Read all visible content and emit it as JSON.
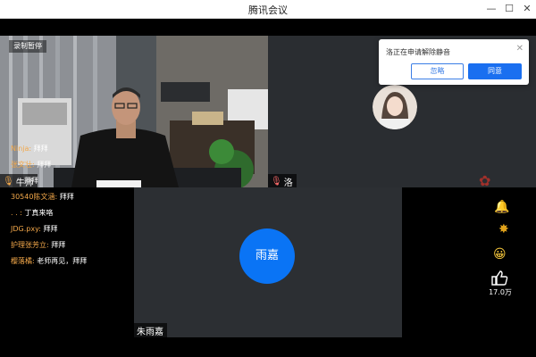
{
  "window": {
    "title": "腾讯会议",
    "minimize": "—",
    "maximize": "☐",
    "close": "✕"
  },
  "recording_badge": "录制暂停",
  "tiles": {
    "presenter": {
      "name": "牛师"
    },
    "guest": {
      "name": "洛"
    },
    "speaker": {
      "name": "朱雨嘉",
      "avatar_text": "雨嘉"
    }
  },
  "chat": [
    {
      "who": "Ninja",
      "msg": "拜拜"
    },
    {
      "who": "张文壮",
      "msg": "拜拜"
    },
    {
      "who": "",
      "msg": "拜拜"
    },
    {
      "who": "30540陈文涵",
      "msg": "拜拜"
    },
    {
      "who": ". .",
      "msg": "丁真来咯"
    },
    {
      "who": "JDG.pxy",
      "msg": "拜拜"
    },
    {
      "who": "护理张芳立",
      "msg": "拜拜"
    },
    {
      "who": "樱落橘",
      "msg": "老师再见，拜拜"
    }
  ],
  "unmute_request": {
    "message": "洛正在申请解除静音",
    "ignore_label": "忽略",
    "agree_label": "同意"
  },
  "reactions": {
    "like_count": "17.0万"
  },
  "colors": {
    "accent": "#1a6ff0",
    "chat_name": "#f3a84a",
    "avatar_bg": "#0a74f5"
  }
}
